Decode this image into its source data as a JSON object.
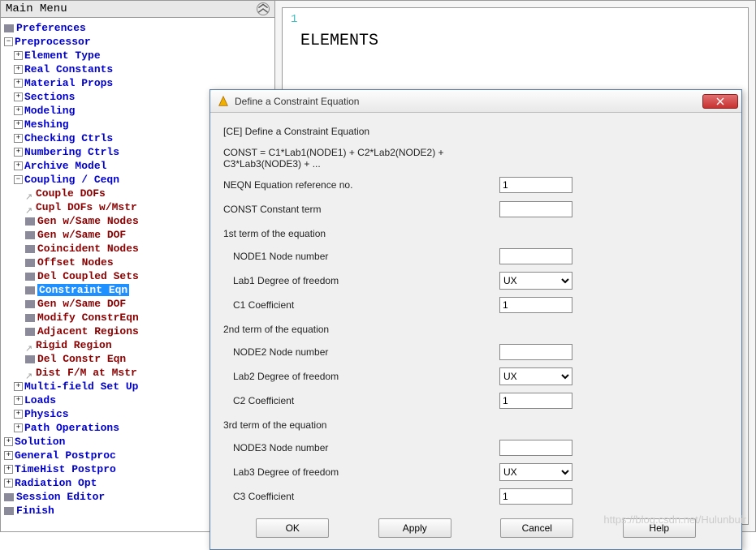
{
  "menu": {
    "title": "Main Menu",
    "items": [
      {
        "lvl": 0,
        "exp": "box",
        "label": "Preferences",
        "color": "blue",
        "leaf": true
      },
      {
        "lvl": 0,
        "exp": "minus",
        "label": "Preprocessor",
        "color": "blue"
      },
      {
        "lvl": 1,
        "exp": "plus",
        "label": "Element Type",
        "color": "blue"
      },
      {
        "lvl": 1,
        "exp": "plus",
        "label": "Real Constants",
        "color": "blue"
      },
      {
        "lvl": 1,
        "exp": "plus",
        "label": "Material Props",
        "color": "blue"
      },
      {
        "lvl": 1,
        "exp": "plus",
        "label": "Sections",
        "color": "blue"
      },
      {
        "lvl": 1,
        "exp": "plus",
        "label": "Modeling",
        "color": "blue"
      },
      {
        "lvl": 1,
        "exp": "plus",
        "label": "Meshing",
        "color": "blue"
      },
      {
        "lvl": 1,
        "exp": "plus",
        "label": "Checking Ctrls",
        "color": "blue"
      },
      {
        "lvl": 1,
        "exp": "plus",
        "label": "Numbering Ctrls",
        "color": "blue"
      },
      {
        "lvl": 1,
        "exp": "plus",
        "label": "Archive Model",
        "color": "blue"
      },
      {
        "lvl": 1,
        "exp": "minus",
        "label": "Coupling / Ceqn",
        "color": "blue"
      },
      {
        "lvl": 2,
        "exp": "arrow",
        "label": "Couple DOFs",
        "color": "red"
      },
      {
        "lvl": 2,
        "exp": "arrow",
        "label": "Cupl DOFs w/Mstr",
        "color": "red"
      },
      {
        "lvl": 2,
        "exp": "box",
        "label": "Gen w/Same Nodes",
        "color": "red",
        "leaf": true
      },
      {
        "lvl": 2,
        "exp": "box",
        "label": "Gen w/Same DOF",
        "color": "red",
        "leaf": true
      },
      {
        "lvl": 2,
        "exp": "box",
        "label": "Coincident Nodes",
        "color": "red",
        "leaf": true
      },
      {
        "lvl": 2,
        "exp": "box",
        "label": "Offset Nodes",
        "color": "red",
        "leaf": true
      },
      {
        "lvl": 2,
        "exp": "box",
        "label": "Del Coupled Sets",
        "color": "red",
        "leaf": true
      },
      {
        "lvl": 2,
        "exp": "box",
        "label": "Constraint Eqn",
        "color": "red",
        "leaf": true,
        "selected": true
      },
      {
        "lvl": 2,
        "exp": "box",
        "label": "Gen w/Same DOF",
        "color": "red",
        "leaf": true
      },
      {
        "lvl": 2,
        "exp": "box",
        "label": "Modify ConstrEqn",
        "color": "red",
        "leaf": true
      },
      {
        "lvl": 2,
        "exp": "box",
        "label": "Adjacent Regions",
        "color": "red",
        "leaf": true
      },
      {
        "lvl": 2,
        "exp": "arrow",
        "label": "Rigid Region",
        "color": "red"
      },
      {
        "lvl": 2,
        "exp": "box",
        "label": "Del Constr Eqn",
        "color": "red",
        "leaf": true
      },
      {
        "lvl": 2,
        "exp": "arrow",
        "label": "Dist F/M at Mstr",
        "color": "red"
      },
      {
        "lvl": 1,
        "exp": "plus",
        "label": "Multi-field Set Up",
        "color": "blue"
      },
      {
        "lvl": 1,
        "exp": "plus",
        "label": "Loads",
        "color": "blue"
      },
      {
        "lvl": 1,
        "exp": "plus",
        "label": "Physics",
        "color": "blue"
      },
      {
        "lvl": 1,
        "exp": "plus",
        "label": "Path Operations",
        "color": "blue"
      },
      {
        "lvl": 0,
        "exp": "plus",
        "label": "Solution",
        "color": "blue"
      },
      {
        "lvl": 0,
        "exp": "plus",
        "label": "General Postproc",
        "color": "blue"
      },
      {
        "lvl": 0,
        "exp": "plus",
        "label": "TimeHist Postpro",
        "color": "blue"
      },
      {
        "lvl": 0,
        "exp": "plus",
        "label": "Radiation Opt",
        "color": "blue"
      },
      {
        "lvl": 0,
        "exp": "box",
        "label": "Session Editor",
        "color": "blue",
        "leaf": true
      },
      {
        "lvl": 0,
        "exp": "box",
        "label": "Finish",
        "color": "blue",
        "leaf": true
      }
    ]
  },
  "canvas": {
    "num": "1",
    "title": "ELEMENTS"
  },
  "dialog": {
    "title": "Define a Constraint Equation",
    "heading": "[CE]  Define a Constraint Equation",
    "formula": "CONST = C1*Lab1(NODE1) + C2*Lab2(NODE2) + C3*Lab3(NODE3) + ...",
    "neqn_label": "NEQN   Equation reference no.",
    "neqn_value": "1",
    "const_label": "CONST  Constant term",
    "const_value": "",
    "sections": [
      {
        "title": "1st term of the equation",
        "node_label": "NODE1  Node number",
        "node_value": "",
        "lab_label": "Lab1    Degree of freedom",
        "lab_value": "UX",
        "c_label": "C1       Coefficient",
        "c_value": "1"
      },
      {
        "title": "2nd term of the equation",
        "node_label": "NODE2  Node number",
        "node_value": "",
        "lab_label": "Lab2    Degree of freedom",
        "lab_value": "UX",
        "c_label": "C2       Coefficient",
        "c_value": "1"
      },
      {
        "title": "3rd term of the equation",
        "node_label": "NODE3  Node number",
        "node_value": "",
        "lab_label": "Lab3    Degree of freedom",
        "lab_value": "UX",
        "c_label": "C3       Coefficient",
        "c_value": "1"
      }
    ],
    "dof_options": [
      "UX"
    ],
    "buttons": {
      "ok": "OK",
      "apply": "Apply",
      "cancel": "Cancel",
      "help": "Help"
    }
  },
  "watermark": "https://blog.csdn.net/Hulunbuir"
}
